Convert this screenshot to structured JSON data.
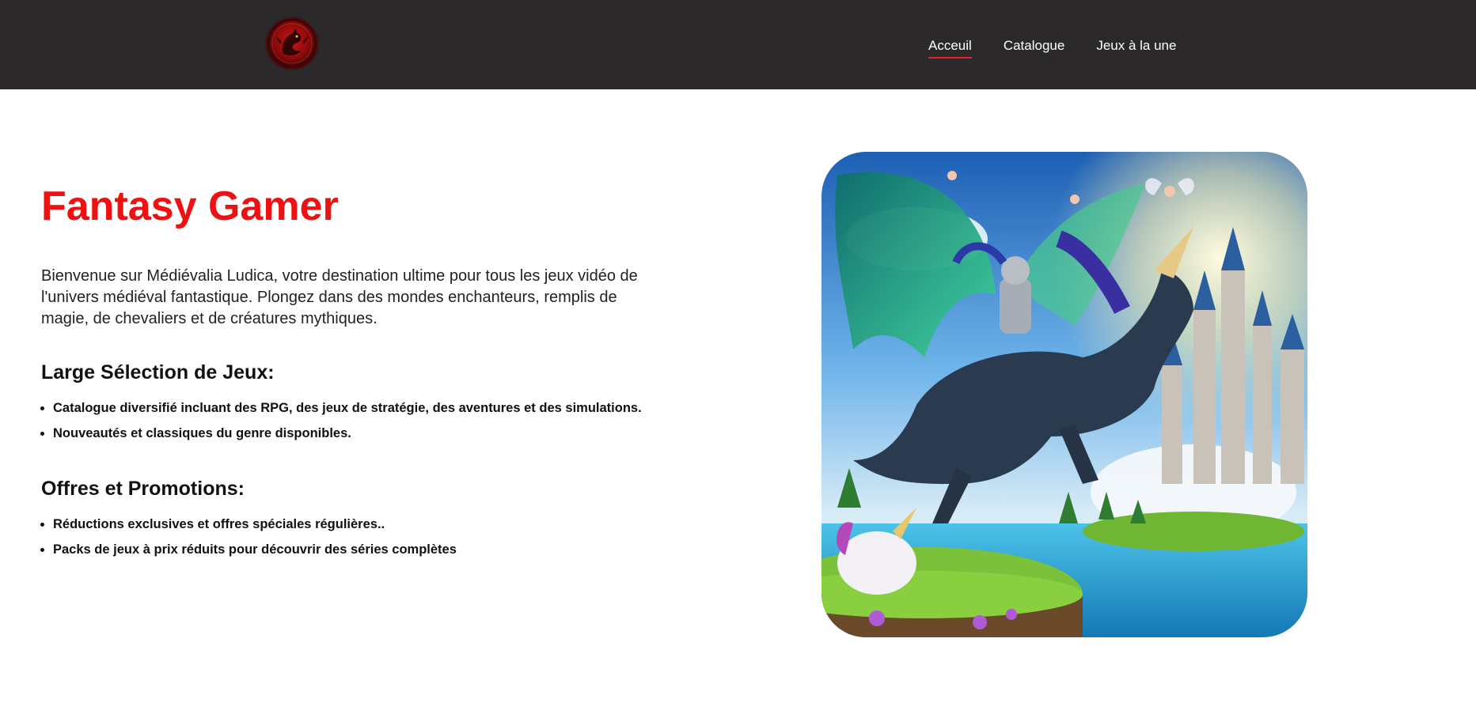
{
  "nav": {
    "logo_icon": "red-dragon-emblem-icon",
    "links": [
      {
        "label": "Acceuil",
        "active": true
      },
      {
        "label": "Catalogue",
        "active": false
      },
      {
        "label": "Jeux à la une",
        "active": false
      }
    ]
  },
  "main": {
    "title": "Fantasy Gamer",
    "intro": "Bienvenue sur Médiévalia Ludica, votre destination ultime pour tous les jeux vidéo de l'univers médiéval fantastique. Plongez dans des mondes enchanteurs, remplis de magie, de chevaliers et de créatures mythiques.",
    "sections": [
      {
        "heading": "Large Sélection de Jeux:",
        "items": [
          "Catalogue diversifié incluant des RPG, des jeux de stratégie, des aventures et des simulations.",
          "Nouveautés et classiques du genre disponibles."
        ]
      },
      {
        "heading": "Offres et Promotions:",
        "items": [
          "Réductions exclusives et offres spéciales régulières..",
          "Packs de jeux à prix réduits pour découvrir des séries complètes"
        ]
      }
    ],
    "hero_image": "knight-riding-winged-unicorn-dragon-illustration"
  },
  "colors": {
    "navbar_bg": "#2b2929",
    "title": "#ee1111",
    "active_underline": "#e8212b"
  }
}
